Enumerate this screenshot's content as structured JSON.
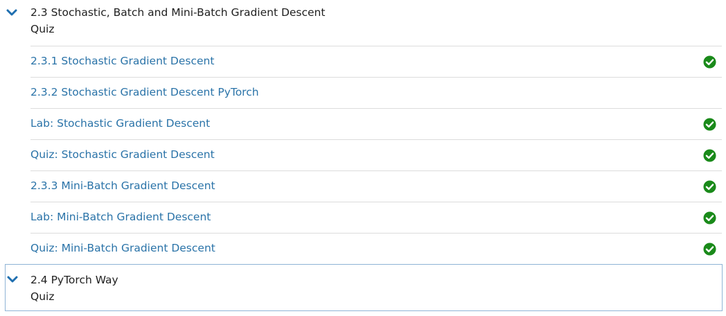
{
  "sections": [
    {
      "title": "2.3 Stochastic, Batch and Mini-Batch Gradient Descent",
      "subtitle": "Quiz",
      "items": [
        {
          "label": "2.3.1 Stochastic Gradient Descent",
          "completed": true
        },
        {
          "label": "2.3.2 Stochastic Gradient Descent PyTorch",
          "completed": false
        },
        {
          "label": "Lab: Stochastic Gradient Descent",
          "completed": true
        },
        {
          "label": "Quiz: Stochastic Gradient Descent",
          "completed": true
        },
        {
          "label": "2.3.3 Mini-Batch Gradient Descent",
          "completed": true
        },
        {
          "label": "Lab: Mini-Batch Gradient Descent",
          "completed": true
        },
        {
          "label": "Quiz: Mini-Batch Gradient Descent",
          "completed": true
        }
      ]
    },
    {
      "title": "2.4 PyTorch Way",
      "subtitle": "Quiz",
      "items": []
    }
  ],
  "icons": {
    "expand": "chevron-down-icon",
    "completed": "check-circle-icon"
  },
  "colors": {
    "link": "#2a73a8",
    "chevron": "#1f6fb0",
    "check": "#1a8a1a",
    "divider": "#dcdcdc",
    "focus_border": "#8fb4d6",
    "text": "#1f1f1f"
  }
}
